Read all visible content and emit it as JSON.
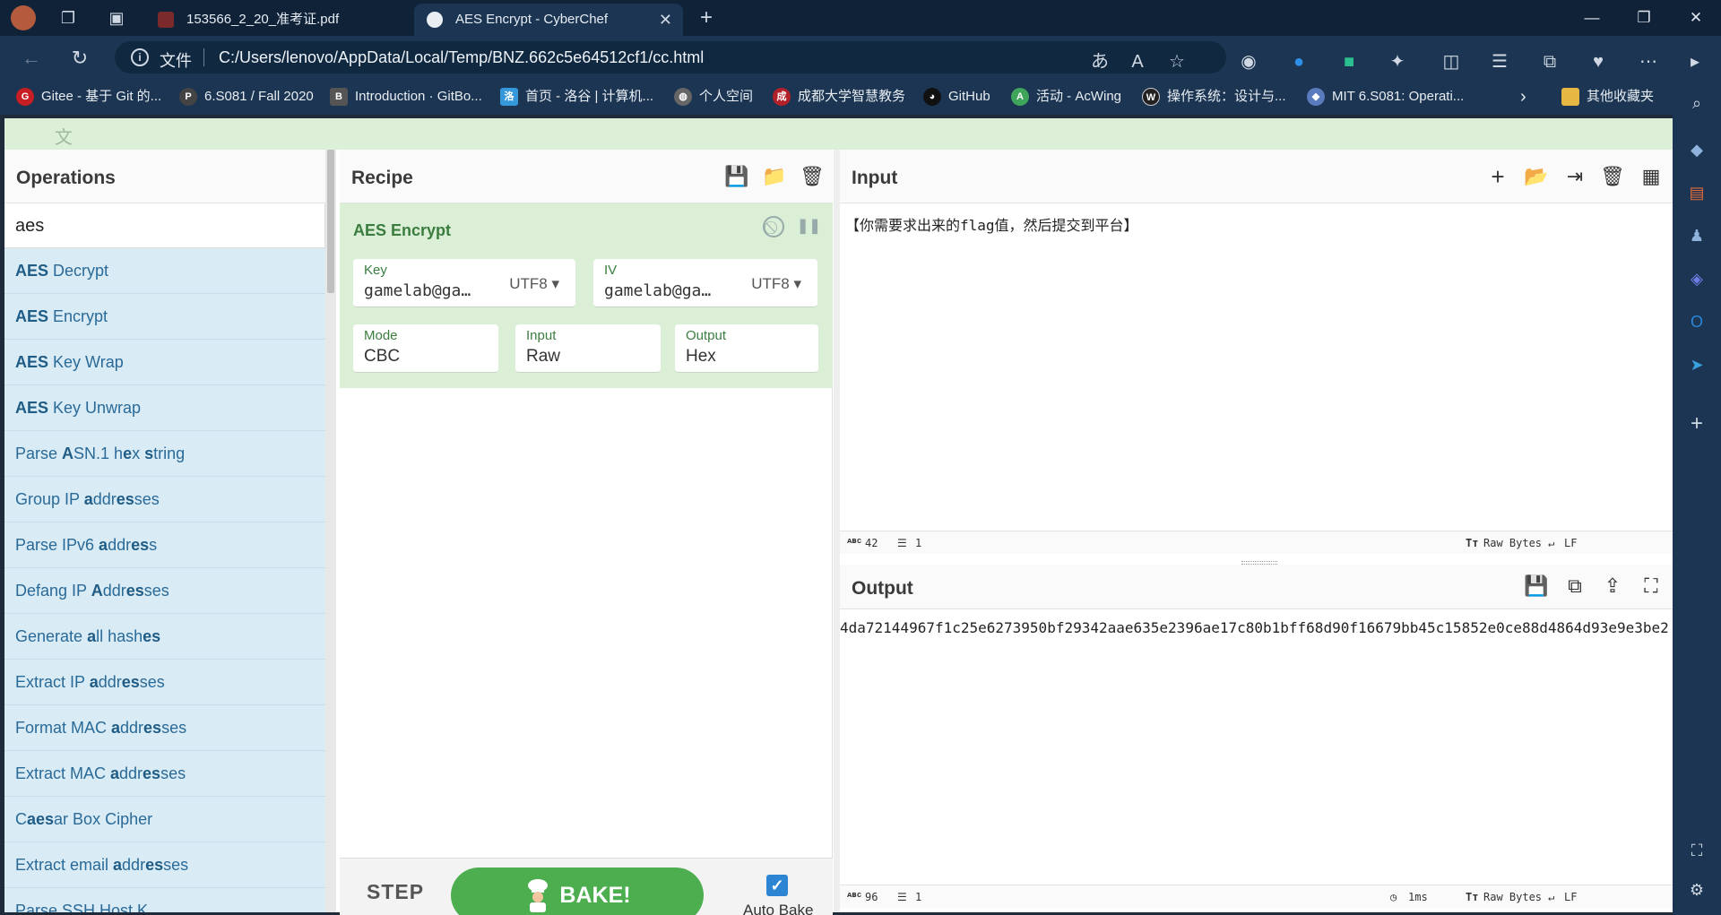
{
  "browser": {
    "tabs": [
      {
        "title": "153566_2_20_准考证.pdf",
        "active": false
      },
      {
        "title": "AES Encrypt - CyberChef",
        "active": true
      }
    ],
    "address": {
      "label": "文件",
      "url": "C:/Users/lenovo/AppData/Local/Temp/BNZ.662c5e64512cf1/cc.html"
    },
    "bookmarks": [
      {
        "label": "Gitee - 基于 Git 的...",
        "icon": "gitee-icon",
        "color": "#c71d23"
      },
      {
        "label": "6.S081 / Fall 2020",
        "icon": "pdos-icon",
        "color": "#444444"
      },
      {
        "label": "Introduction · GitBo...",
        "icon": "gitbook-icon",
        "color": "#555555"
      },
      {
        "label": "首页 - 洛谷 | 计算机...",
        "icon": "luogu-icon",
        "color": "#3498db"
      },
      {
        "label": "个人空间",
        "icon": "globe-icon",
        "color": "#666666"
      },
      {
        "label": "成都大学智慧教务",
        "icon": "school-icon",
        "color": "#b3202a"
      },
      {
        "label": "GitHub",
        "icon": "github-icon",
        "color": "#111111"
      },
      {
        "label": "活动 - AcWing",
        "icon": "acwing-icon",
        "color": "#3fa55b"
      },
      {
        "label": "操作系统：设计与...",
        "icon": "os-icon",
        "color": "#222222"
      },
      {
        "label": "MIT 6.S081: Operati...",
        "icon": "mit-icon",
        "color": "#5b7bbf"
      }
    ],
    "other_bookmarks": "其他收藏夹"
  },
  "ops": {
    "title": "Operations",
    "search_value": "aes",
    "items": [
      {
        "pre": "",
        "b": "AES",
        "post": " Decrypt"
      },
      {
        "pre": "",
        "b": "AES",
        "post": " Encrypt"
      },
      {
        "pre": "",
        "b": "AES",
        "post": " Key Wrap"
      },
      {
        "pre": "",
        "b": "AES",
        "post": " Key Unwrap"
      },
      {
        "html": "Parse <b>A</b>SN.1 h<b>e</b>x <b>s</b>tring"
      },
      {
        "html": "Group IP <b>a</b>ddr<b>es</b>ses"
      },
      {
        "html": "Parse IPv6 <b>a</b>ddr<b>es</b>s"
      },
      {
        "html": "Defang IP <b>A</b>ddr<b>es</b>ses"
      },
      {
        "html": "Generate <b>a</b>ll hash<b>es</b>"
      },
      {
        "html": "Extract IP <b>a</b>ddr<b>es</b>ses"
      },
      {
        "html": "Format MAC <b>a</b>ddr<b>es</b>ses"
      },
      {
        "html": "Extract MAC <b>a</b>ddr<b>es</b>ses"
      },
      {
        "html": "C<b>aes</b>ar Box Cipher"
      },
      {
        "html": "Extract email <b>a</b>ddr<b>es</b>ses"
      },
      {
        "html": "Parse SSH Host K..."
      }
    ]
  },
  "recipe": {
    "title": "Recipe",
    "op_name": "AES Encrypt",
    "key": {
      "label": "Key",
      "value": "gamelab@ga…",
      "encoding": "UTF8"
    },
    "iv": {
      "label": "IV",
      "value": "gamelab@ga…",
      "encoding": "UTF8"
    },
    "mode": {
      "label": "Mode",
      "value": "CBC"
    },
    "input": {
      "label": "Input",
      "value": "Raw"
    },
    "output": {
      "label": "Output",
      "value": "Hex"
    },
    "step_label": "STEP",
    "bake_label": "BAKE!",
    "autobake_label": "Auto Bake",
    "autobake_checked": true
  },
  "input": {
    "title": "Input",
    "text": "【你需要求出来的flag值，然后提交到平台】",
    "length": "42",
    "lines": "1",
    "encoding": "Raw Bytes",
    "eol": "LF"
  },
  "output": {
    "title": "Output",
    "text": "4da72144967f1c25e6273950bf29342aae635e2396ae17c80b1bff68d90f16679bb45c15852e0ce88d4864d93e9e3be2",
    "length": "96",
    "lines": "1",
    "time": "1ms",
    "encoding": "Raw Bytes",
    "eol": "LF"
  }
}
